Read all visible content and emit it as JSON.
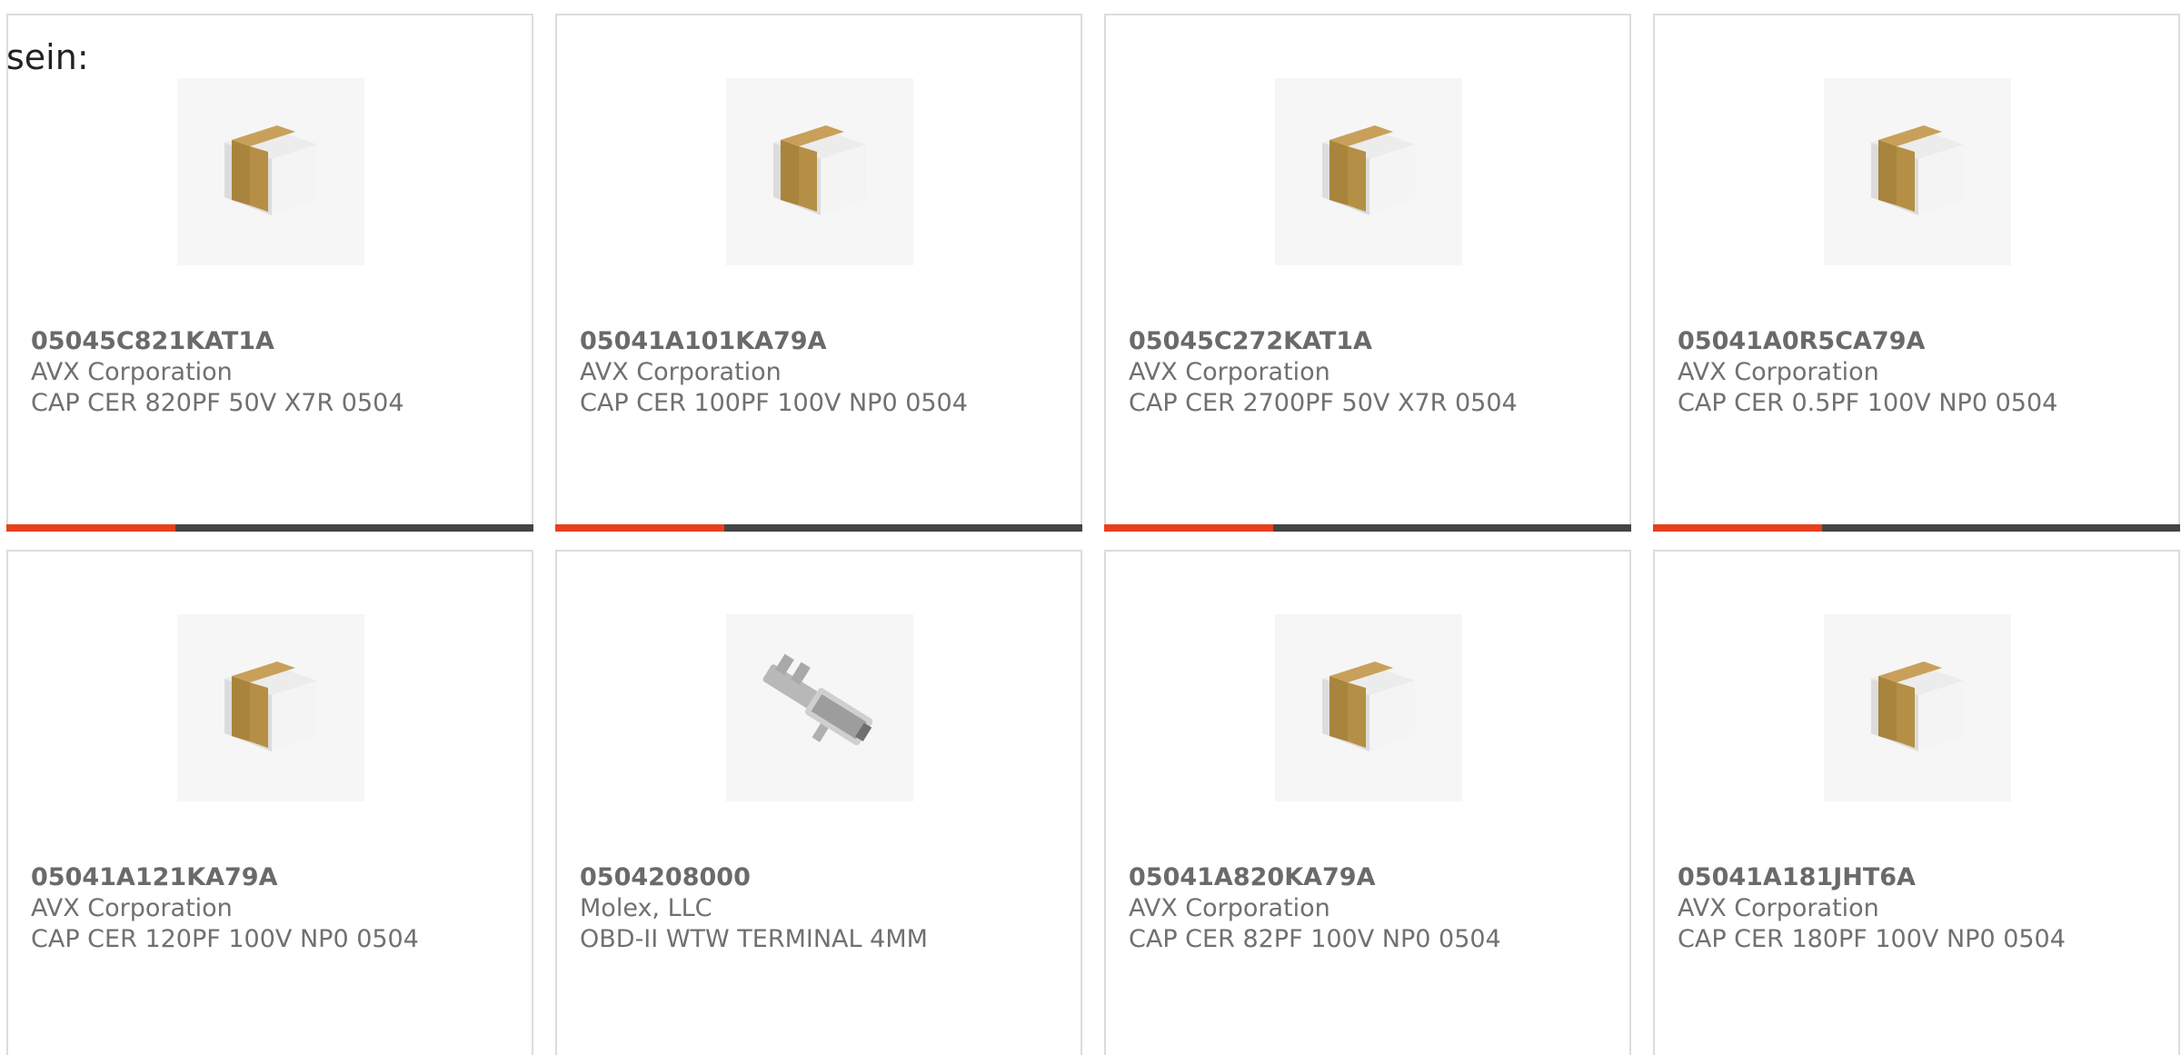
{
  "prefix_text": "sein:",
  "accent_color": "#e8401c",
  "bar_track_color": "#444444",
  "products": [
    {
      "part_number": "05045C821KAT1A",
      "manufacturer": "AVX Corporation",
      "description": "CAP CER 820PF 50V X7R 0504",
      "image": "ceramic-capacitor-chip",
      "progress": 0.32
    },
    {
      "part_number": "05041A101KA79A",
      "manufacturer": "AVX Corporation",
      "description": "CAP CER 100PF 100V NP0 0504",
      "image": "ceramic-capacitor-chip",
      "progress": 0.32
    },
    {
      "part_number": "05045C272KAT1A",
      "manufacturer": "AVX Corporation",
      "description": "CAP CER 2700PF 50V X7R 0504",
      "image": "ceramic-capacitor-chip",
      "progress": 0.32
    },
    {
      "part_number": "05041A0R5CA79A",
      "manufacturer": "AVX Corporation",
      "description": "CAP CER 0.5PF 100V NP0 0504",
      "image": "ceramic-capacitor-chip",
      "progress": 0.32
    },
    {
      "part_number": "05041A121KA79A",
      "manufacturer": "AVX Corporation",
      "description": "CAP CER 120PF 100V NP0 0504",
      "image": "ceramic-capacitor-chip"
    },
    {
      "part_number": "0504208000",
      "manufacturer": "Molex, LLC",
      "description": "OBD-II WTW TERMINAL 4MM",
      "image": "crimp-terminal"
    },
    {
      "part_number": "05041A820KA79A",
      "manufacturer": "AVX Corporation",
      "description": "CAP CER 82PF 100V NP0 0504",
      "image": "ceramic-capacitor-chip"
    },
    {
      "part_number": "05041A181JHT6A",
      "manufacturer": "AVX Corporation",
      "description": "CAP CER 180PF 100V NP0 0504",
      "image": "ceramic-capacitor-chip"
    }
  ]
}
